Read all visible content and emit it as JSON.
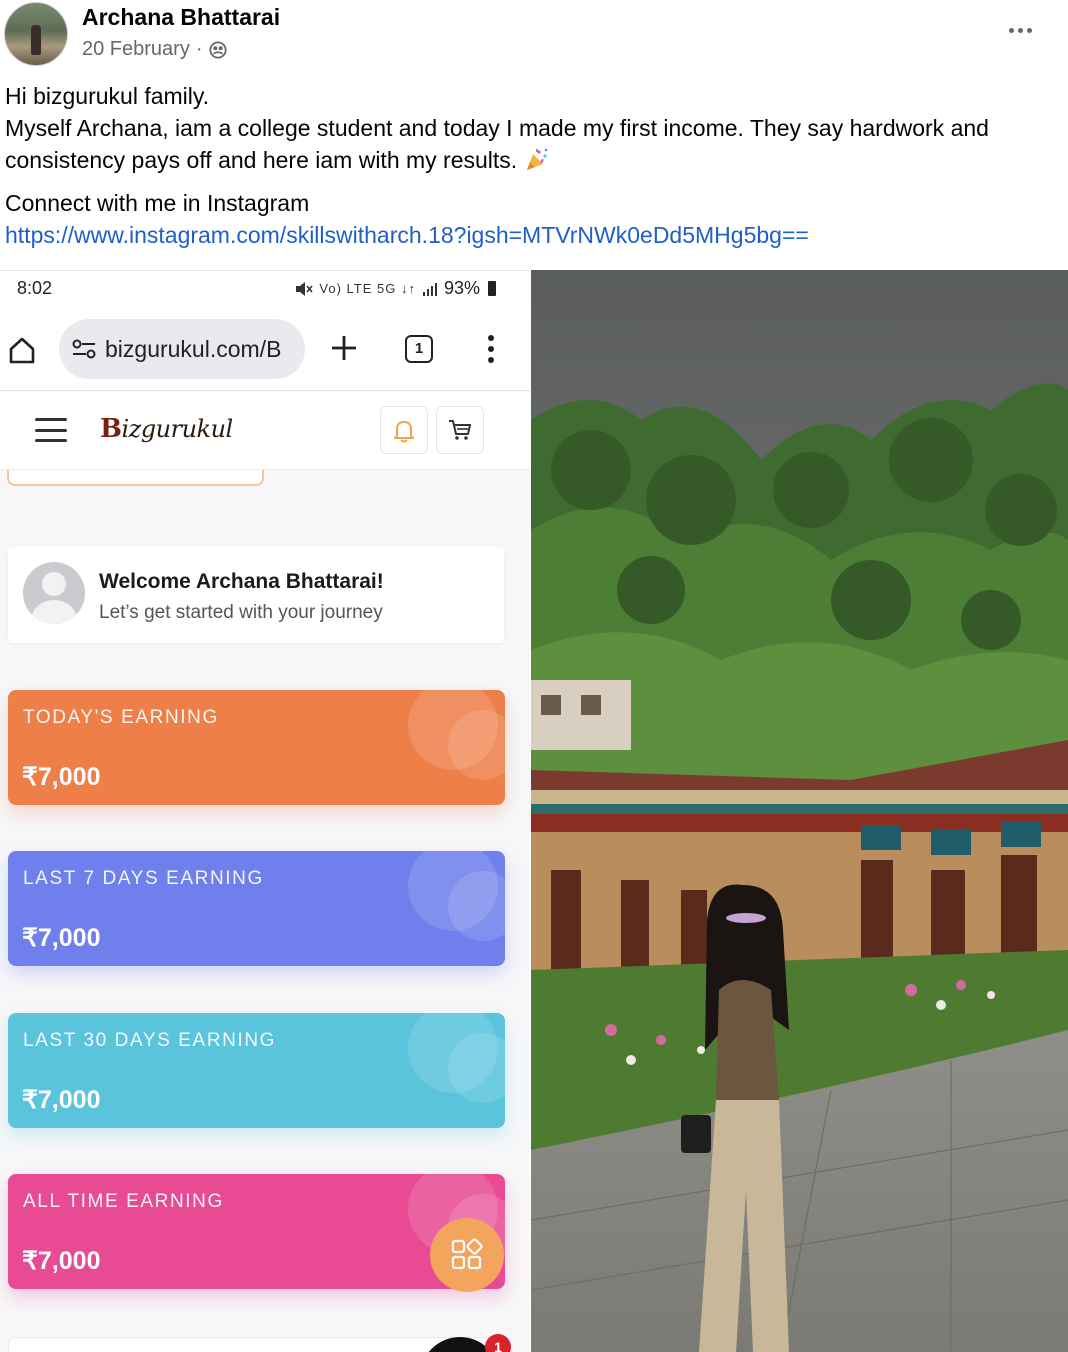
{
  "post": {
    "author": "Archana Bhattarai",
    "date": "20 February",
    "separator": "·",
    "privacy_icon": "globe-icon",
    "more_icon": "more-options-icon",
    "text_line1": "Hi bizgurukul family.",
    "text_line2": "Myself Archana, iam a college student and today I made my first income. They say hardwork and consistency pays off and here iam with my results.",
    "text_emoji": "party-popper-icon",
    "text_line3": "Connect with me in Instagram",
    "link": "https://www.instagram.com/skillswitharch.18?igsh=MTVrNWk0eDd5MHg5bg=="
  },
  "phone": {
    "status": {
      "time": "8:02",
      "indicators": "Vo) LTE 5G ↓↑",
      "battery": "93%"
    },
    "browser": {
      "url": "bizgurukul.com/B",
      "tab_count": "1"
    },
    "site": {
      "logo_initial": "B",
      "logo_rest": "izgurukul"
    },
    "welcome": {
      "title": "Welcome Archana Bhattarai!",
      "subtitle": "Let’s get started with your journey"
    },
    "earnings": [
      {
        "label": "TODAY'S EARNING",
        "value": "₹7,000",
        "color": "#ee7f48"
      },
      {
        "label": "LAST 7 DAYS EARNING",
        "value": "₹7,000",
        "color": "#6f80ec"
      },
      {
        "label": "LAST 30 DAYS EARNING",
        "value": "₹7,000",
        "color": "#5ac4dc"
      },
      {
        "label": "ALL TIME EARNING",
        "value": "₹7,000",
        "color": "#e84b93"
      }
    ],
    "notification_count": "1"
  }
}
